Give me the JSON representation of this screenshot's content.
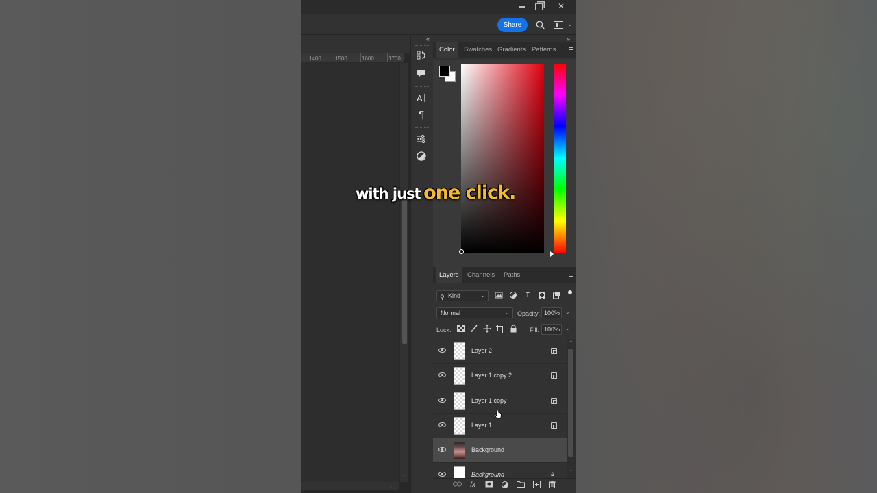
{
  "topbar": {
    "share_label": "Share",
    "icons": [
      "minimize-icon",
      "restore-icon",
      "close-icon",
      "search-icon",
      "workspace-icon"
    ]
  },
  "ruler": {
    "ticks": [
      "1400",
      "1500",
      "1600",
      "1700"
    ]
  },
  "color_panel": {
    "tabs": [
      "Color",
      "Swatches",
      "Gradients",
      "Patterns"
    ],
    "active_tab": "Color",
    "foreground": "#000000",
    "background": "#ffffff",
    "hue_color": "#e00010"
  },
  "layers_panel": {
    "tabs": [
      "Layers",
      "Channels",
      "Paths"
    ],
    "active_tab": "Layers",
    "filter_kind": "Kind",
    "blend_mode": "Normal",
    "opacity_label": "Opacity:",
    "opacity_value": "100%",
    "lock_label": "Lock:",
    "fill_label": "Fill:",
    "fill_value": "100%",
    "layers": [
      {
        "name": "Layer 2",
        "visible": true,
        "thumb": "transparent",
        "selected": false
      },
      {
        "name": "Layer 1 copy 2",
        "visible": true,
        "thumb": "transparent",
        "selected": false
      },
      {
        "name": "Layer 1 copy",
        "visible": true,
        "thumb": "transparent",
        "selected": false
      },
      {
        "name": "Layer 1",
        "visible": true,
        "thumb": "transparent",
        "selected": false
      },
      {
        "name": "Background",
        "visible": true,
        "thumb": "photo",
        "selected": true
      },
      {
        "name": "Background",
        "visible": true,
        "thumb": "white",
        "selected": false,
        "locked": true
      }
    ]
  },
  "caption": {
    "white_text": "with just",
    "yellow_text": "one click."
  }
}
